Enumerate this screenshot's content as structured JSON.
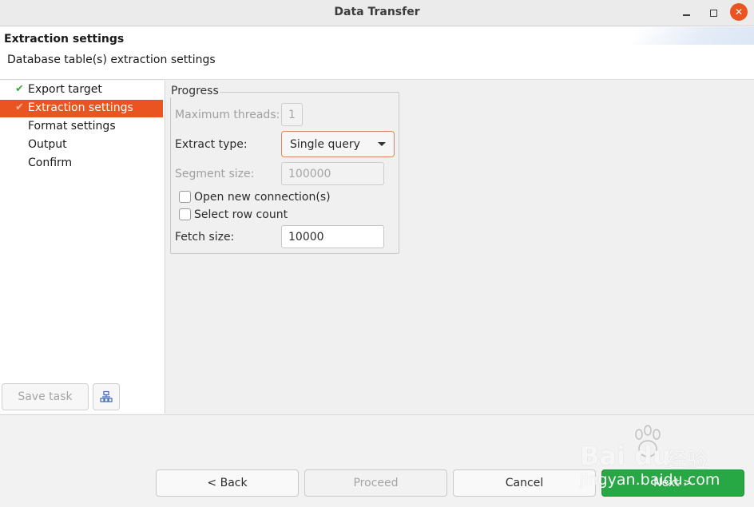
{
  "window": {
    "title": "Data Transfer",
    "controls": {
      "minimize_icon": "minimize-icon",
      "maximize_icon": "maximize-icon",
      "close_icon": "close-icon"
    }
  },
  "header": {
    "title": "Extraction settings",
    "subtitle": "Database table(s) extraction settings"
  },
  "sidebar": {
    "items": [
      {
        "label": "Export target",
        "checked": true,
        "active": false
      },
      {
        "label": "Extraction settings",
        "checked": true,
        "active": true
      },
      {
        "label": "Format settings",
        "checked": false,
        "active": false
      },
      {
        "label": "Output",
        "checked": false,
        "active": false
      },
      {
        "label": "Confirm",
        "checked": false,
        "active": false
      }
    ],
    "save_task_label": "Save task",
    "task_icon": "task-config-icon"
  },
  "progress": {
    "legend": "Progress",
    "max_threads_label": "Maximum threads:",
    "max_threads_value": "1",
    "extract_type_label": "Extract type:",
    "extract_type_value": "Single query",
    "segment_size_label": "Segment size:",
    "segment_size_value": "100000",
    "open_new_connection_label": "Open new connection(s)",
    "open_new_connection_checked": false,
    "select_row_count_label": "Select row count",
    "select_row_count_checked": false,
    "fetch_size_label": "Fetch size:",
    "fetch_size_value": "10000"
  },
  "footer": {
    "back_label": "< Back",
    "proceed_label": "Proceed",
    "cancel_label": "Cancel",
    "next_label": "Next >"
  },
  "watermark": {
    "brand": "Bai du",
    "cn": "经验",
    "url": "jingyan.baidu.com"
  },
  "colors": {
    "accent": "#e95420",
    "primary_button": "#28a745",
    "check": "#3aa640"
  }
}
